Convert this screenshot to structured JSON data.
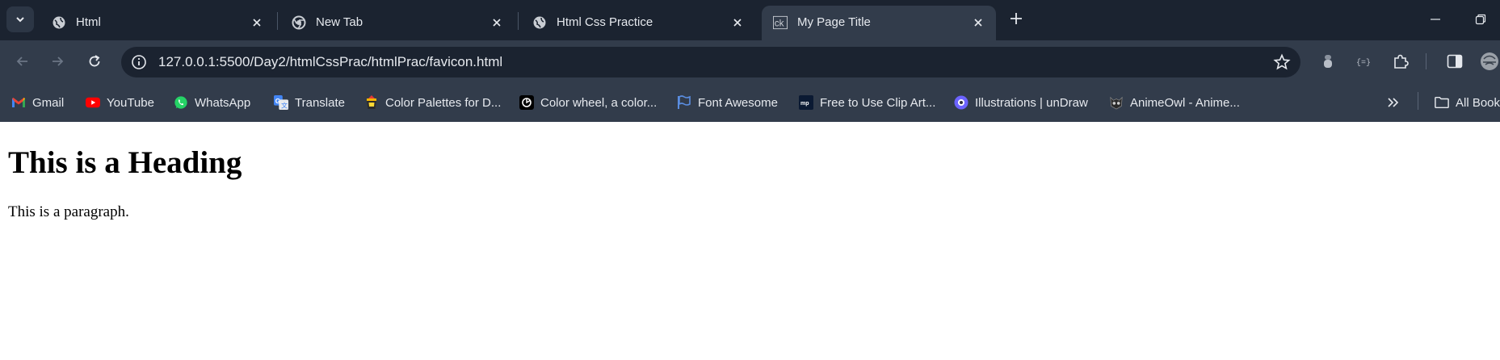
{
  "tabs": [
    {
      "title": "Html",
      "favicon": "globe-icon",
      "active": false
    },
    {
      "title": "New Tab",
      "favicon": "chrome-icon",
      "active": false
    },
    {
      "title": "Html Css Practice",
      "favicon": "globe-icon",
      "active": false
    },
    {
      "title": "My Page Title",
      "favicon": "ck-icon",
      "active": true
    }
  ],
  "address_bar": {
    "url": "127.0.0.1:5500/Day2/htmlCssPrac/htmlPrac/favicon.html"
  },
  "bookmarks": [
    {
      "label": "Gmail",
      "icon": "gmail-icon"
    },
    {
      "label": "YouTube",
      "icon": "youtube-icon"
    },
    {
      "label": "WhatsApp",
      "icon": "whatsapp-icon"
    },
    {
      "label": "Translate",
      "icon": "translate-icon"
    },
    {
      "label": "Color Palettes for D...",
      "icon": "palette-icon"
    },
    {
      "label": "Color wheel, a color...",
      "icon": "color-wheel-icon"
    },
    {
      "label": "Font Awesome",
      "icon": "flag-icon"
    },
    {
      "label": "Free to Use Clip Art...",
      "icon": "clipart-icon"
    },
    {
      "label": "Illustrations | unDraw",
      "icon": "undraw-icon"
    },
    {
      "label": "AnimeOwl - Anime...",
      "icon": "owl-icon"
    }
  ],
  "all_bookmarks_label": "All Bookmarks",
  "page": {
    "heading": "This is a Heading",
    "paragraph": "This is a paragraph."
  },
  "colors": {
    "tabstrip_bg": "#1b2330",
    "toolbar_bg": "#323c4b",
    "text": "#e6e9ee"
  }
}
